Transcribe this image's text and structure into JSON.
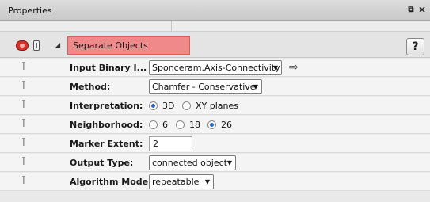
{
  "panel": {
    "title": "Properties",
    "float_glyph": "⧉",
    "close_glyph": "×"
  },
  "module": {
    "name": "Separate Objects",
    "collapse_glyph": "◢",
    "help_label": "?"
  },
  "pin_glyph": "⍑",
  "rows": {
    "input": {
      "label": "Input Binary I...",
      "value": "Sponceram.Axis-Connectivity",
      "go_glyph": "⇨"
    },
    "method": {
      "label": "Method:",
      "value": "Chamfer - Conservative"
    },
    "interpretation": {
      "label": "Interpretation:",
      "options": [
        "3D",
        "XY planes"
      ],
      "selected": "3D"
    },
    "neighborhood": {
      "label": "Neighborhood:",
      "options": [
        "6",
        "18",
        "26"
      ],
      "selected": "26"
    },
    "marker_extent": {
      "label": "Marker Extent:",
      "value": "2"
    },
    "output_type": {
      "label": "Output Type:",
      "value": "connected object"
    },
    "algorithm_mode": {
      "label": "Algorithm Mode:",
      "value": "repeatable"
    }
  },
  "dropdown_arrow": "▼",
  "colors": {
    "module_name_bg": "#f08a8a",
    "radio_selected": "#2a66c8",
    "module_icon": "#d8322d"
  }
}
